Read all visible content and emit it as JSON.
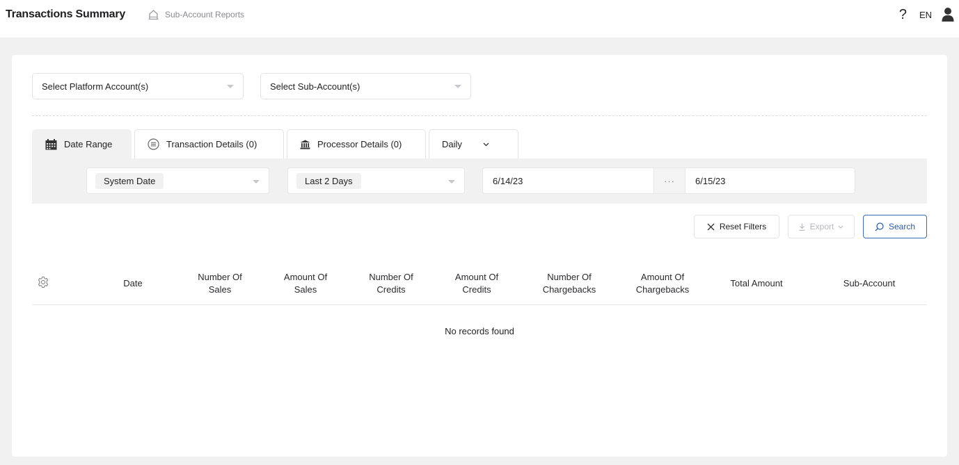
{
  "header": {
    "title": "Transactions Summary",
    "breadcrumb": "Sub-Account Reports",
    "help": "?",
    "language": "EN"
  },
  "filters": {
    "platform_account_placeholder": "Select Platform Account(s)",
    "sub_account_placeholder": "Select Sub-Account(s)"
  },
  "tabs": [
    {
      "label": "Date Range",
      "icon": "calendar-icon"
    },
    {
      "label": "Transaction Details (0)",
      "icon": "list-icon"
    },
    {
      "label": "Processor Details (0)",
      "icon": "bank-icon"
    },
    {
      "label": "Daily",
      "icon": "chevron-down-icon"
    }
  ],
  "date_range": {
    "date_type": "System Date",
    "period": "Last 2 Days",
    "start": "6/14/23",
    "separator": "···",
    "end": "6/15/23"
  },
  "actions": {
    "reset": "Reset Filters",
    "export": "Export",
    "search": "Search"
  },
  "table": {
    "columns": [
      {
        "line1": "Date",
        "line2": ""
      },
      {
        "line1": "Number Of",
        "line2": "Sales"
      },
      {
        "line1": "Amount Of",
        "line2": "Sales"
      },
      {
        "line1": "Number Of",
        "line2": "Credits"
      },
      {
        "line1": "Amount Of",
        "line2": "Credits"
      },
      {
        "line1": "Number Of",
        "line2": "Chargebacks"
      },
      {
        "line1": "Amount Of",
        "line2": "Chargebacks"
      },
      {
        "line1": "Total Amount",
        "line2": ""
      },
      {
        "line1": "Sub-Account",
        "line2": ""
      }
    ],
    "empty_message": "No records found"
  },
  "colors": {
    "accent": "#2a5aa3",
    "background": "#f1f1f2"
  }
}
